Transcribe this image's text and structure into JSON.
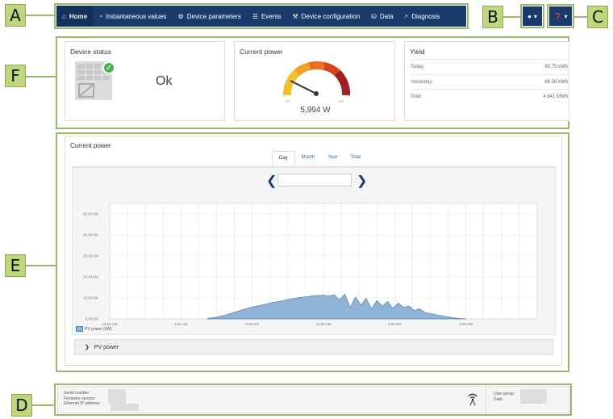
{
  "callouts": {
    "a": "A",
    "b": "B",
    "c": "C",
    "d": "D",
    "e": "E",
    "f": "F"
  },
  "nav": {
    "items": [
      {
        "label": "Home",
        "icon": "home-icon"
      },
      {
        "label": "Instantaneous values",
        "icon": "gauge-icon"
      },
      {
        "label": "Device parameters",
        "icon": "gear-icon"
      },
      {
        "label": "Events",
        "icon": "list-icon"
      },
      {
        "label": "Device configuration",
        "icon": "wrench-icon"
      },
      {
        "label": "Data",
        "icon": "database-icon"
      },
      {
        "label": "Diagnosis",
        "icon": "search-icon"
      }
    ],
    "user_menu": "user-icon",
    "help_menu": "help-icon"
  },
  "device_status": {
    "title": "Device status",
    "status": "Ok"
  },
  "current_power_card": {
    "title": "Current power",
    "value": "5,994 W"
  },
  "yield": {
    "title": "Yield",
    "rows": [
      {
        "label": "Today:",
        "value": "80.75 kWh"
      },
      {
        "label": "Yesterday:",
        "value": "66.38 kWh"
      },
      {
        "label": "Total:",
        "value": "4.841 MWh"
      }
    ]
  },
  "chart_panel": {
    "title": "Current power",
    "tabs": [
      "Day",
      "Month",
      "Year",
      "Total"
    ],
    "active_tab": "Day",
    "legend": "PV power (kW)",
    "collapse_label": "PV power"
  },
  "chart_data": {
    "type": "area",
    "title": "",
    "xlabel": "",
    "ylabel": "",
    "y_tick_labels": [
      "0.00 kW",
      "10.00 kW",
      "20.00 kW",
      "30.00 kW",
      "40.00 kW",
      "50.00 kW"
    ],
    "x_tick_labels": [
      "12:00 AM",
      "4:00 AM",
      "8:00 AM",
      "12:00 PM",
      "4:00 PM",
      "8:00 PM"
    ],
    "ylim": [
      0,
      55
    ],
    "xlim": [
      0,
      24
    ],
    "grid": true,
    "series": [
      {
        "name": "PV power (kW)",
        "x": [
          5.5,
          6.0,
          6.5,
          7.0,
          7.5,
          8.0,
          8.5,
          9.0,
          9.5,
          10.0,
          10.5,
          11.0,
          11.5,
          12.0,
          12.3,
          12.6,
          12.9,
          13.2,
          13.5,
          13.8,
          14.1,
          14.4,
          14.7,
          15.0,
          15.3,
          15.6,
          15.9,
          16.2,
          16.5,
          16.8,
          17.1,
          17.4,
          17.7,
          18.0,
          18.4,
          18.8,
          19.2,
          19.6,
          20.0
        ],
        "y": [
          0.2,
          0.8,
          1.8,
          3.2,
          4.5,
          5.6,
          6.5,
          7.5,
          8.3,
          9.2,
          10.0,
          10.5,
          11.0,
          11.3,
          10.8,
          11.5,
          9.0,
          11.8,
          5.5,
          10.5,
          6.5,
          9.8,
          4.8,
          8.8,
          6.0,
          8.3,
          5.0,
          7.5,
          5.5,
          6.2,
          4.0,
          4.8,
          3.0,
          2.6,
          1.8,
          1.2,
          0.6,
          0.2,
          0.0
        ]
      }
    ]
  },
  "footer": {
    "serial_label": "Serial number:",
    "firmware_label": "Firmware version:",
    "ip_label": "Ethernet IP address:",
    "user_group_label": "User group:",
    "date_label": "Date:",
    "wifi_icon": "wifi-signal-icon"
  },
  "colors": {
    "nav": "#1a3b6b",
    "callout": "#bed67c",
    "frame": "#9ab86b",
    "area_fill": "#8fb4d8",
    "area_line": "#4f7fae"
  }
}
